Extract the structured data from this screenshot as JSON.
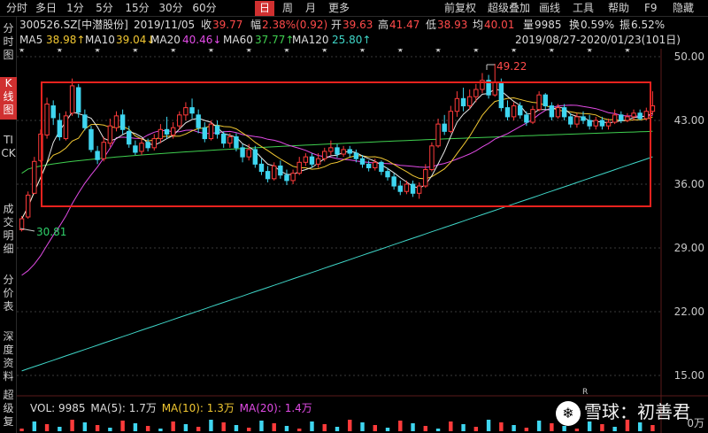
{
  "toolbar": {
    "tabs": [
      "分时",
      "多日",
      "1分",
      "5分",
      "15分",
      "30分",
      "60分",
      "日",
      "周",
      "月",
      "更多"
    ],
    "active_tab": "日",
    "menus": [
      "前复权",
      "超级叠加",
      "画线",
      "工具",
      "帮助",
      "F9",
      "隐藏"
    ]
  },
  "info": {
    "code": "300526.SZ[中潜股份]",
    "date": "2019/11/05",
    "close_label": "收",
    "close": "39.77",
    "change_label": "幅",
    "change": "2.38%(0.92)",
    "open_label": "开",
    "open": "39.63",
    "high_label": "高",
    "high": "41.47",
    "low_label": "低",
    "low": "38.93",
    "avg_label": "均",
    "avg": "40.01",
    "vol_label": "量",
    "vol": "9985",
    "turnover_label": "换",
    "turnover": "0.59%",
    "amplitude_label": "振",
    "amplitude": "6.52%"
  },
  "ma": {
    "ma5_label": "MA5",
    "ma5": "38.98↑",
    "ma10_label": "MA10",
    "ma10": "39.04↓",
    "ma20_label": "MA20",
    "ma20": "40.46↓",
    "ma60_label": "MA60",
    "ma60": "37.77↑",
    "ma120_label": "MA120",
    "ma120": "25.80↑",
    "range": "2019/08/27-2020/01/23(101日)",
    "colors": {
      "ma5": "#e8e8e8",
      "ma10": "#f2c832",
      "ma20": "#e24be6",
      "ma60": "#3fcf4f",
      "ma120": "#3fd6c8"
    }
  },
  "left_nav": [
    {
      "label": "分时图",
      "active": false
    },
    {
      "label": "K线图",
      "active": true
    },
    {
      "label": "TICK",
      "active": false
    },
    {
      "label": "成交明细",
      "active": false
    },
    {
      "label": "分价表",
      "active": false
    },
    {
      "label": "深度资料",
      "active": false
    },
    {
      "label": "超级复",
      "active": false
    }
  ],
  "axis": {
    "price_ticks": [
      "50.00",
      "43.00",
      "36.00",
      "29.00",
      "22.00",
      "15.00"
    ],
    "vol_tick": "0万"
  },
  "annotations": {
    "high": "49.22",
    "low": "30.81",
    "r_marker": "R"
  },
  "volume": {
    "label": "VOL: 9985",
    "ma5": "MA(5): 1.7万",
    "ma10": "MA(10): 1.3万",
    "ma20": "MA(20): 1.4万"
  },
  "watermark": {
    "logo": "❄",
    "text": "雪球：初善君"
  },
  "chart_data": {
    "type": "candlestick",
    "ylim": [
      15.0,
      50.0
    ],
    "candles": [
      [
        31.0,
        32.2,
        30.81,
        32.5
      ],
      [
        32.4,
        34.8,
        32.2,
        35.2
      ],
      [
        35.0,
        38.5,
        34.9,
        39.0
      ],
      [
        38.6,
        41.5,
        38.4,
        42.0
      ],
      [
        41.4,
        44.8,
        41.0,
        45.5
      ],
      [
        44.6,
        43.3,
        42.5,
        45.2
      ],
      [
        43.0,
        41.2,
        40.8,
        43.8
      ],
      [
        41.0,
        43.5,
        40.8,
        44.0
      ],
      [
        43.8,
        46.8,
        43.5,
        47.6
      ],
      [
        46.6,
        43.9,
        43.3,
        47.0
      ],
      [
        43.6,
        42.2,
        41.9,
        44.2
      ],
      [
        42.0,
        39.8,
        39.5,
        42.4
      ],
      [
        39.6,
        38.7,
        38.2,
        40.2
      ],
      [
        38.8,
        40.6,
        38.5,
        41.2
      ],
      [
        40.5,
        42.4,
        40.1,
        43.2
      ],
      [
        42.2,
        43.5,
        41.8,
        44.0
      ],
      [
        43.6,
        42.0,
        41.5,
        44.2
      ],
      [
        41.8,
        40.4,
        40.0,
        42.4
      ],
      [
        40.2,
        39.5,
        39.2,
        40.8
      ],
      [
        39.6,
        40.5,
        39.2,
        41.0
      ],
      [
        40.6,
        40.0,
        39.6,
        41.0
      ],
      [
        40.0,
        41.0,
        39.7,
        41.5
      ],
      [
        41.0,
        42.0,
        40.5,
        42.6
      ],
      [
        42.0,
        41.5,
        41.0,
        43.4
      ],
      [
        41.4,
        42.2,
        41.0,
        42.8
      ],
      [
        42.4,
        43.6,
        42.0,
        44.0
      ],
      [
        43.6,
        44.4,
        43.0,
        45.0
      ],
      [
        44.4,
        43.8,
        43.2,
        45.4
      ],
      [
        43.6,
        42.2,
        41.6,
        44.2
      ],
      [
        42.2,
        41.0,
        40.6,
        42.8
      ],
      [
        41.0,
        42.6,
        40.8,
        43.0
      ],
      [
        42.4,
        41.5,
        41.0,
        43.0
      ],
      [
        41.5,
        40.5,
        40.0,
        41.8
      ],
      [
        40.5,
        41.2,
        40.0,
        41.6
      ],
      [
        41.2,
        40.0,
        39.6,
        41.6
      ],
      [
        40.0,
        39.0,
        38.4,
        40.4
      ],
      [
        39.0,
        39.8,
        38.6,
        40.4
      ],
      [
        39.8,
        38.2,
        37.8,
        40.2
      ],
      [
        38.2,
        37.4,
        37.0,
        38.8
      ],
      [
        37.4,
        36.6,
        36.2,
        38.0
      ],
      [
        36.6,
        38.0,
        36.4,
        38.4
      ],
      [
        38.0,
        37.0,
        36.6,
        38.6
      ],
      [
        37.0,
        36.4,
        35.9,
        37.6
      ],
      [
        36.4,
        37.2,
        36.0,
        37.6
      ],
      [
        37.2,
        38.4,
        37.0,
        39.0
      ],
      [
        38.4,
        39.0,
        38.0,
        39.4
      ],
      [
        39.0,
        38.2,
        37.8,
        39.4
      ],
      [
        38.2,
        38.8,
        37.8,
        39.4
      ],
      [
        38.8,
        39.6,
        38.5,
        40.0
      ],
      [
        39.6,
        40.0,
        39.2,
        40.8
      ],
      [
        40.0,
        39.3,
        38.9,
        40.4
      ],
      [
        39.3,
        39.8,
        39.0,
        40.2
      ],
      [
        39.8,
        39.4,
        39.0,
        40.2
      ],
      [
        39.4,
        38.8,
        38.4,
        39.8
      ],
      [
        38.8,
        38.2,
        37.8,
        39.2
      ],
      [
        38.2,
        37.8,
        37.4,
        38.6
      ],
      [
        37.8,
        38.4,
        37.5,
        38.8
      ],
      [
        38.4,
        37.4,
        37.0,
        38.6
      ],
      [
        37.4,
        36.8,
        36.4,
        37.8
      ],
      [
        36.8,
        35.8,
        35.4,
        37.2
      ],
      [
        35.8,
        35.2,
        34.8,
        36.4
      ],
      [
        35.2,
        36.0,
        34.9,
        36.4
      ],
      [
        36.0,
        35.0,
        34.6,
        36.4
      ],
      [
        35.0,
        35.8,
        34.4,
        36.2
      ],
      [
        35.8,
        37.6,
        35.6,
        38.2
      ],
      [
        37.6,
        40.2,
        37.4,
        40.6
      ],
      [
        40.2,
        42.6,
        40.0,
        43.2
      ],
      [
        42.6,
        41.8,
        41.4,
        43.6
      ],
      [
        41.8,
        44.0,
        41.6,
        44.6
      ],
      [
        44.0,
        45.4,
        43.4,
        46.2
      ],
      [
        45.4,
        44.6,
        44.0,
        46.6
      ],
      [
        44.6,
        45.6,
        44.2,
        46.4
      ],
      [
        45.6,
        46.4,
        45.0,
        47.0
      ],
      [
        46.4,
        47.4,
        46.0,
        48.2
      ],
      [
        47.4,
        45.8,
        45.4,
        48.0
      ],
      [
        45.8,
        47.2,
        45.6,
        49.22
      ],
      [
        47.2,
        44.4,
        44.0,
        47.6
      ],
      [
        44.4,
        43.4,
        43.0,
        45.2
      ],
      [
        43.4,
        44.6,
        43.0,
        45.0
      ],
      [
        44.6,
        43.6,
        43.2,
        45.0
      ],
      [
        43.6,
        42.8,
        42.4,
        44.0
      ],
      [
        42.8,
        44.2,
        42.6,
        44.6
      ],
      [
        44.2,
        45.8,
        44.0,
        46.2
      ],
      [
        45.8,
        44.6,
        44.2,
        46.0
      ],
      [
        44.6,
        43.4,
        43.0,
        45.0
      ],
      [
        43.4,
        44.4,
        43.2,
        44.8
      ],
      [
        44.4,
        43.4,
        43.0,
        44.8
      ],
      [
        43.4,
        42.6,
        42.2,
        43.8
      ],
      [
        42.6,
        43.4,
        42.2,
        43.8
      ],
      [
        43.4,
        43.0,
        42.6,
        44.0
      ],
      [
        43.0,
        42.4,
        42.0,
        43.6
      ],
      [
        42.4,
        43.0,
        42.0,
        43.4
      ],
      [
        43.0,
        42.4,
        42.0,
        43.4
      ],
      [
        42.4,
        42.8,
        42.0,
        43.2
      ],
      [
        42.8,
        43.6,
        42.6,
        44.2
      ],
      [
        43.6,
        43.0,
        42.7,
        44.0
      ],
      [
        43.0,
        43.4,
        42.8,
        43.8
      ],
      [
        43.4,
        43.8,
        43.0,
        44.2
      ],
      [
        43.8,
        43.2,
        43.0,
        44.2
      ],
      [
        43.2,
        44.0,
        43.0,
        44.4
      ],
      [
        44.0,
        44.6,
        43.6,
        46.2
      ]
    ],
    "ma60": {
      "from": 37.2,
      "to": 41.8
    },
    "ma120": {
      "from": 15.5,
      "to": 39.0
    }
  }
}
